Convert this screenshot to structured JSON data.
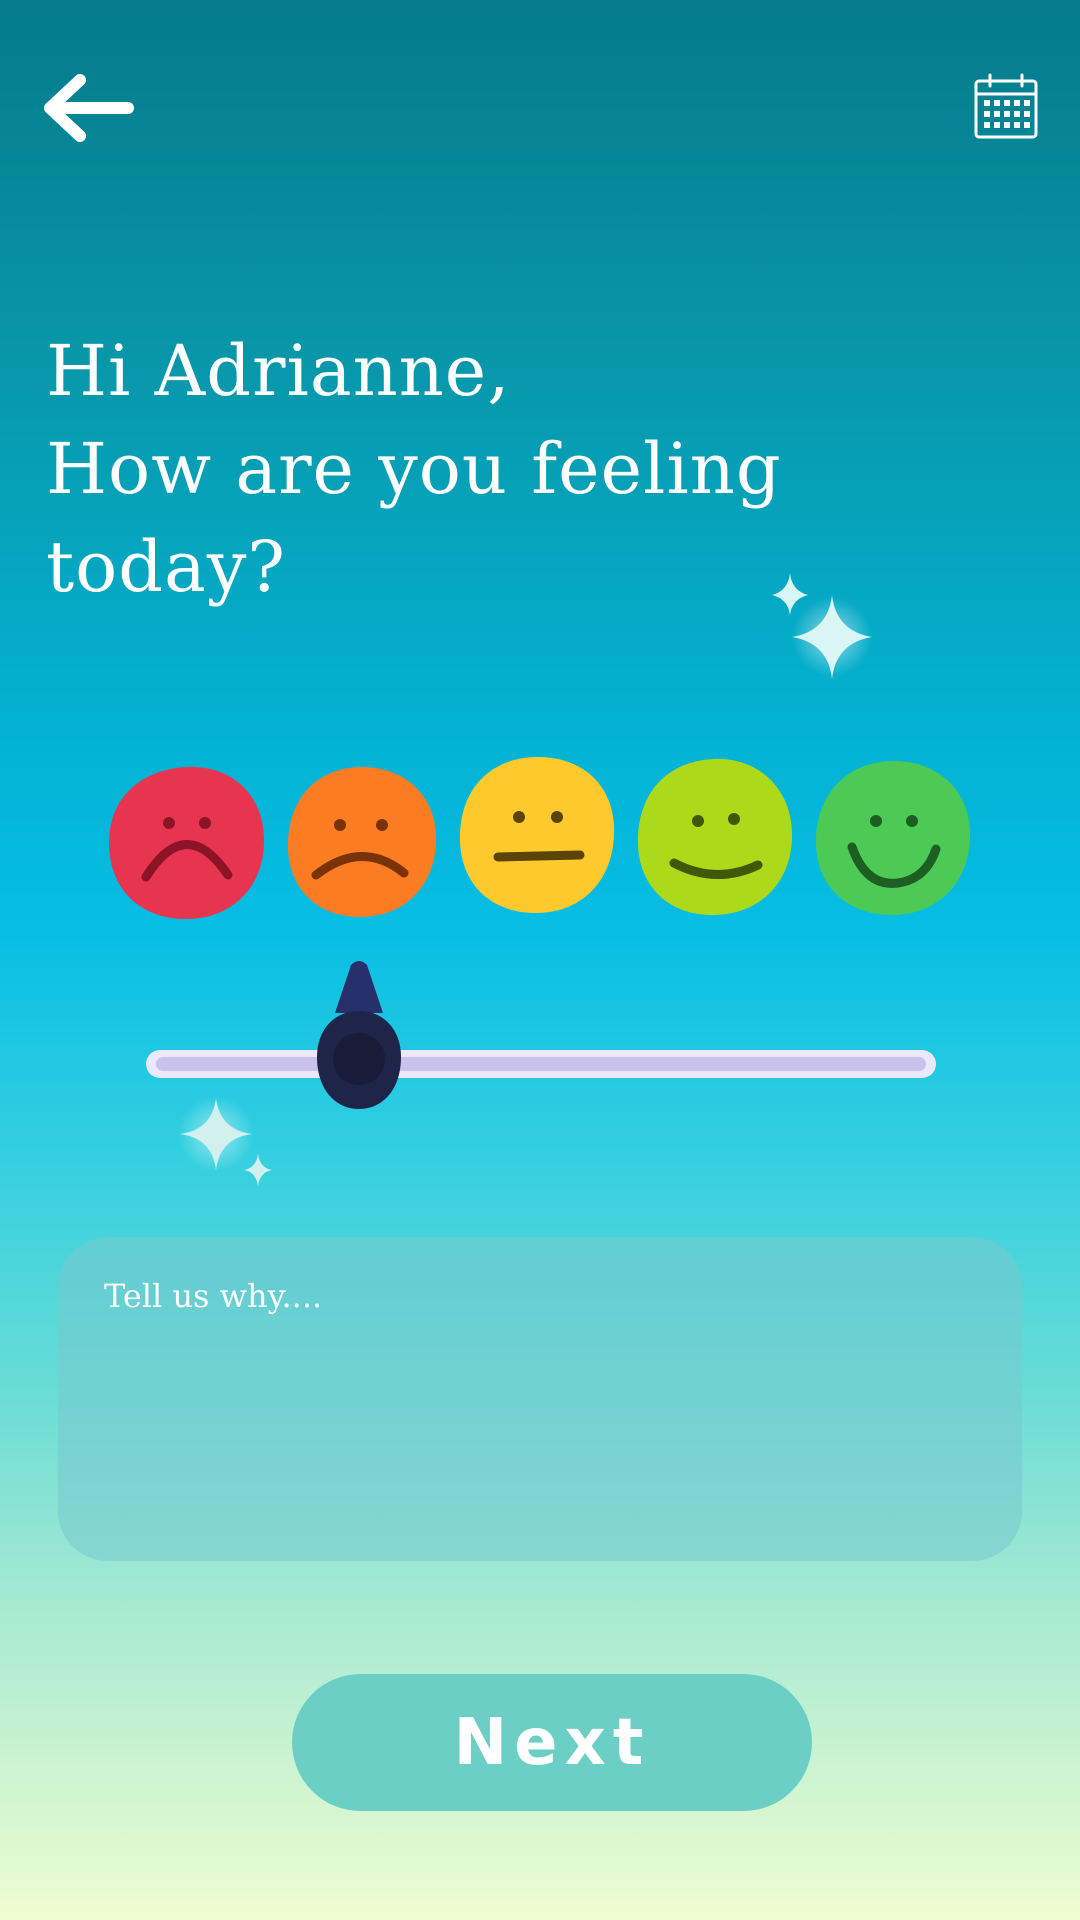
{
  "header": {
    "back_icon": "arrow-left-icon",
    "calendar_icon": "calendar-icon"
  },
  "greeting": {
    "line1": "Hi Adrianne,",
    "line2": "How are you feeling",
    "line3": "today?"
  },
  "moods": [
    {
      "id": "very-sad",
      "color": "#e8354f",
      "feature_color": "#8c1426",
      "icon": "very-sad-face-icon"
    },
    {
      "id": "sad",
      "color": "#fb7c22",
      "feature_color": "#7a3308",
      "icon": "sad-face-icon"
    },
    {
      "id": "neutral",
      "color": "#fdc92d",
      "feature_color": "#5a4408",
      "icon": "neutral-face-icon"
    },
    {
      "id": "happy",
      "color": "#acd91a",
      "feature_color": "#3f5a06",
      "icon": "happy-face-icon"
    },
    {
      "id": "very-happy",
      "color": "#4dca56",
      "feature_color": "#1d5e22",
      "icon": "very-happy-face-icon"
    }
  ],
  "slider": {
    "selected_mood": "sad",
    "value": 0.27,
    "thumb_color": "#1e2549",
    "track_color": "#c9c2ea"
  },
  "why_field": {
    "placeholder": "Tell us why....",
    "value": ""
  },
  "next_button": {
    "label": "Next"
  }
}
